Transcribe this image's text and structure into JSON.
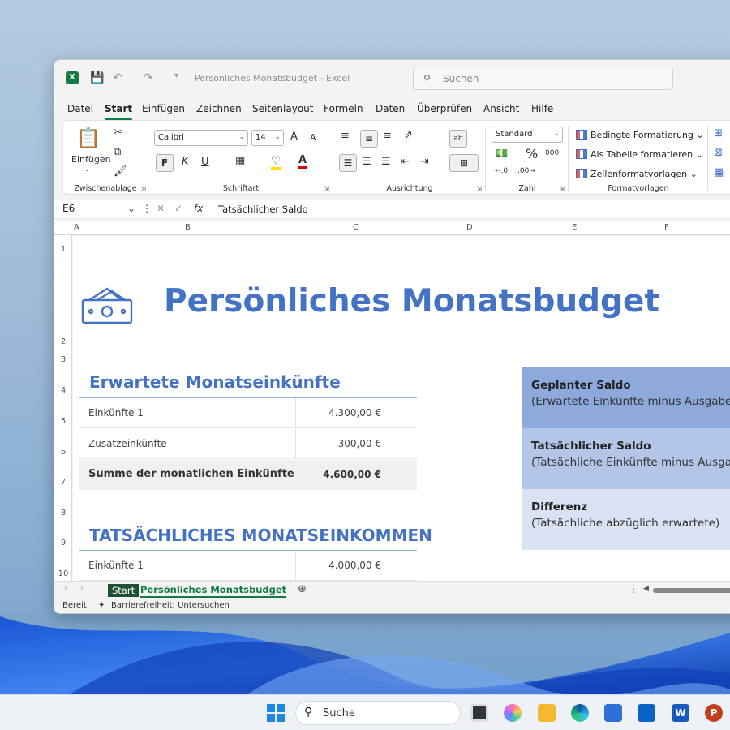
{
  "window": {
    "title": "Persönliches Monatsbudget  -  Excel",
    "search_placeholder": "Suchen"
  },
  "menu": [
    "Datei",
    "Start",
    "Einfügen",
    "Zeichnen",
    "Seitenlayout",
    "Formeln",
    "Daten",
    "Überprüfen",
    "Ansicht",
    "Hilfe"
  ],
  "ribbon": {
    "clipboard": {
      "paste_label": "Einfügen",
      "group": "Zwischenablage"
    },
    "font": {
      "name": "Calibri",
      "size": "14",
      "bold": "F",
      "italic": "K",
      "underline": "U",
      "grow": "A",
      "shrink": "A",
      "group": "Schriftart"
    },
    "alignment": {
      "group": "Ausrichtung"
    },
    "number": {
      "format": "Standard",
      "percent": "%",
      "thousands": "000",
      "group": "Zahl"
    },
    "styles": {
      "conditional": "Bedingte Formatierung",
      "as_table": "Als Tabelle formatieren",
      "cell_styles": "Zellenformatvorlagen",
      "group": "Formatvorlagen"
    }
  },
  "formula_bar": {
    "cell": "E6",
    "fx": "fx",
    "content": "Tatsächlicher Saldo"
  },
  "columns": [
    "A",
    "B",
    "C",
    "D",
    "E",
    "F"
  ],
  "rows": [
    "1",
    "2",
    "3",
    "4",
    "5",
    "6",
    "7",
    "8",
    "9",
    "10"
  ],
  "sheet": {
    "title": "Persönliches Monatsbudget",
    "expected_heading": "Erwartete Monatseinkünfte",
    "expected_rows": [
      {
        "label": "Einkünfte 1",
        "value": "4.300,00 €"
      },
      {
        "label": "Zusatzeinkünfte",
        "value": "300,00 €"
      }
    ],
    "expected_total": {
      "label": "Summe der monatlichen Einkünfte",
      "value": "4.600,00 €"
    },
    "actual_heading": "TATSÄCHLICHES MONATSEINKOMMEN",
    "actual_rows": [
      {
        "label": "Einkünfte 1",
        "value": "4.000,00 €"
      }
    ],
    "panels": [
      {
        "title": "Geplanter Saldo",
        "subtitle": "(Erwartete Einkünfte minus Ausgaben)",
        "color": "#8ea9db"
      },
      {
        "title": "Tatsächlicher Saldo",
        "subtitle": "(Tatsächliche Einkünfte minus Ausgaben)",
        "color": "#b4c6e7"
      },
      {
        "title": "Differenz",
        "subtitle": "(Tatsächliche abzüglich erwartete)",
        "color": "#dae3f3"
      }
    ]
  },
  "sheet_tabs": {
    "start": "Start",
    "active": "Persönliches Monatsbudget"
  },
  "status": {
    "ready": "Bereit",
    "accessibility": "Barrierefreiheit: Untersuchen"
  },
  "taskbar": {
    "search": "Suche"
  },
  "colors": {
    "accent": "#107c41",
    "heading": "#4472c4"
  }
}
